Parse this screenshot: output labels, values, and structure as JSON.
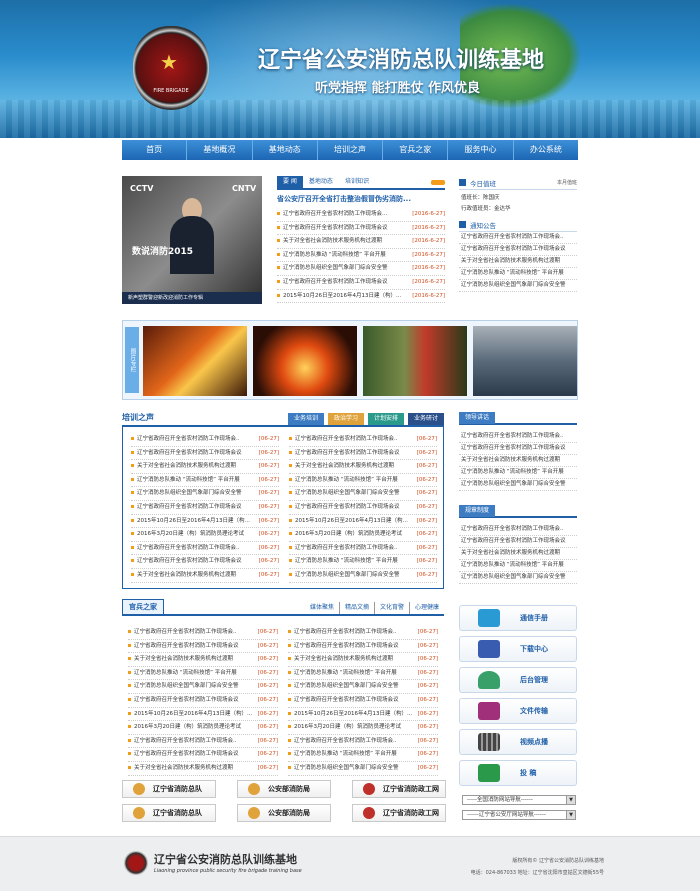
{
  "header": {
    "title": "辽宁省公安消防总队训练基地",
    "slogan": "听党指挥  能打胜仗  作风优良",
    "badge_text": "FIRE BRIGADE"
  },
  "nav": [
    "首页",
    "基地概况",
    "基地动态",
    "培训之声",
    "官兵之家",
    "服务中心",
    "办公系统"
  ],
  "video": {
    "logo_left": "CCTV",
    "logo_right": "CNTV",
    "overlay": "数说消防2015",
    "caption": "新声塑群警迎新改迎消防工作专辑"
  },
  "news": {
    "tabs": [
      "要 闻",
      "基地动态",
      "培训知识"
    ],
    "headline": "省公安厅召开全省打击整治假冒伪劣消防...",
    "items": [
      {
        "title": "辽宁省政府召开全省农村消防工作现场会...",
        "date": "[2016-6-27]"
      },
      {
        "title": "辽宁省政府召开全省农村消防工作现场会议",
        "date": "[2016-6-27]"
      },
      {
        "title": "关于对全省社会消防技术服务机构过渡期",
        "date": "[2016-6-27]"
      },
      {
        "title": "辽宁消防总队推动 “流动科技馆” 平台开展",
        "date": "[2016-6-27]"
      },
      {
        "title": "辽宁消防总队组织全国气象部门综合安全警",
        "date": "[2016-6-27]"
      },
      {
        "title": "辽宁省政府召开全省农村消防工作现场会议",
        "date": "[2016-6-27]"
      },
      {
        "title": "2015年10月26日至2016年4月13日建（构）...",
        "date": "[2016-6-27]"
      }
    ]
  },
  "duty": {
    "title": "今日值班",
    "more": "本月值班",
    "leader_label": "值班长：",
    "leader": "陈国庆",
    "staff_label": "行政值班员：",
    "staff": "金达华"
  },
  "notice": {
    "title": "通知公告",
    "items": [
      "辽宁省政府召开全省农村消防工作现场会..",
      "辽宁省政府召开全省农村消防工作现场会议",
      "关于对全省社会消防技术服务机构过渡期",
      "辽宁消防总队推动 “流动科技馆” 平台开展",
      "辽宁消防总队组织全国气象部门综合安全警"
    ]
  },
  "gallery": {
    "label": "图片专栏"
  },
  "training": {
    "title": "培训之声",
    "buttons": [
      {
        "label": "业务培训",
        "color": "#3d7cc2"
      },
      {
        "label": "政治学习",
        "color": "#e0a23a"
      },
      {
        "label": "计划安排",
        "color": "#2a9a8a"
      },
      {
        "label": "业务研讨",
        "color": "#2a4f8a"
      }
    ],
    "left": [
      {
        "title": "辽宁省政府召开全省农村消防工作现场会..",
        "date": "[06-27]"
      },
      {
        "title": "辽宁省政府召开全省农村消防工作现场会议",
        "date": "[06-27]"
      },
      {
        "title": "关于对全省社会消防技术服务机构过渡期",
        "date": "[06-27]"
      },
      {
        "title": "辽宁消防总队推动 “流动科技馆” 平台开展",
        "date": "[06-27]"
      },
      {
        "title": "辽宁消防总队组织全国气象部门综合安全警",
        "date": "[06-27]"
      },
      {
        "title": "辽宁省政府召开全省农村消防工作现场会议",
        "date": "[06-27]"
      },
      {
        "title": "2015年10月26日至2016年4月13日建（构）...",
        "date": "[06-27]"
      },
      {
        "title": "2016年3月20日建（构）筑消防员理论考试",
        "date": "[06-27]"
      },
      {
        "title": "辽宁省政府召开全省农村消防工作现场会..",
        "date": "[06-27]"
      },
      {
        "title": "辽宁省政府召开全省农村消防工作现场会议",
        "date": "[06-27]"
      },
      {
        "title": "关于对全省社会消防技术服务机构过渡期",
        "date": "[06-27]"
      }
    ],
    "right": [
      {
        "title": "辽宁省政府召开全省农村消防工作现场会..",
        "date": "[06-27]"
      },
      {
        "title": "辽宁省政府召开全省农村消防工作现场会议",
        "date": "[06-27]"
      },
      {
        "title": "关于对全省社会消防技术服务机构过渡期",
        "date": "[06-27]"
      },
      {
        "title": "辽宁消防总队推动 “流动科技馆” 平台开展",
        "date": "[06-27]"
      },
      {
        "title": "辽宁消防总队组织全国气象部门综合安全警",
        "date": "[06-27]"
      },
      {
        "title": "辽宁省政府召开全省农村消防工作现场会议",
        "date": "[06-27]"
      },
      {
        "title": "2015年10月26日至2016年4月13日建（构）...",
        "date": "[06-27]"
      },
      {
        "title": "2016年3月20日建（构）筑消防员理论考试",
        "date": "[06-27]"
      },
      {
        "title": "辽宁省政府召开全省农村消防工作现场会..",
        "date": "[06-27]"
      },
      {
        "title": "辽宁消防总队推动 “流动科技馆” 平台开展",
        "date": "[06-27]"
      },
      {
        "title": "辽宁消防总队组织全国气象部门综合安全警",
        "date": "[06-27]"
      }
    ]
  },
  "family": {
    "title": "官兵之家",
    "links": [
      "媒体聚焦",
      "精品文摘",
      "文化育警",
      "心理健康"
    ],
    "left": [
      {
        "title": "辽宁省政府召开全省农村消防工作现场会..",
        "date": "[06-27]"
      },
      {
        "title": "辽宁省政府召开全省农村消防工作现场会议",
        "date": "[06-27]"
      },
      {
        "title": "关于对全省社会消防技术服务机构过渡期",
        "date": "[06-27]"
      },
      {
        "title": "辽宁消防总队推动 “流动科技馆” 平台开展",
        "date": "[06-27]"
      },
      {
        "title": "辽宁消防总队组织全国气象部门综合安全警",
        "date": "[06-27]"
      },
      {
        "title": "辽宁省政府召开全省农村消防工作现场会议",
        "date": "[06-27]"
      },
      {
        "title": "2015年10月26日至2016年4月13日建（构）...",
        "date": "[06-27]"
      },
      {
        "title": "2016年3月20日建（构）筑消防员理论考试",
        "date": "[06-27]"
      },
      {
        "title": "辽宁省政府召开全省农村消防工作现场会..",
        "date": "[06-27]"
      },
      {
        "title": "辽宁省政府召开全省农村消防工作现场会议",
        "date": "[06-27]"
      },
      {
        "title": "关于对全省社会消防技术服务机构过渡期",
        "date": "[06-27]"
      }
    ],
    "right": [
      {
        "title": "辽宁省政府召开全省农村消防工作现场会..",
        "date": "[06-27]"
      },
      {
        "title": "辽宁省政府召开全省农村消防工作现场会议",
        "date": "[06-27]"
      },
      {
        "title": "关于对全省社会消防技术服务机构过渡期",
        "date": "[06-27]"
      },
      {
        "title": "辽宁消防总队推动 “流动科技馆” 平台开展",
        "date": "[06-27]"
      },
      {
        "title": "辽宁消防总队组织全国气象部门综合安全警",
        "date": "[06-27]"
      },
      {
        "title": "辽宁省政府召开全省农村消防工作现场会议",
        "date": "[06-27]"
      },
      {
        "title": "2015年10月26日至2016年4月13日建（构）...",
        "date": "[06-27]"
      },
      {
        "title": "2016年3月20日建（构）筑消防员理论考试",
        "date": "[06-27]"
      },
      {
        "title": "辽宁省政府召开全省农村消防工作现场会..",
        "date": "[06-27]"
      },
      {
        "title": "辽宁消防总队推动 “流动科技馆” 平台开展",
        "date": "[06-27]"
      },
      {
        "title": "辽宁消防总队组织全国气象部门综合安全警",
        "date": "[06-27]"
      }
    ]
  },
  "leader_talk": {
    "title": "领导讲话",
    "items": [
      "辽宁省政府召开全省农村消防工作现场会..",
      "辽宁省政府召开全省农村消防工作现场会议",
      "关于对全省社会消防技术服务机构过渡期",
      "辽宁消防总队推动 “流动科技馆” 平台开展",
      "辽宁消防总队组织全国气象部门综合安全警"
    ]
  },
  "rules": {
    "title": "规章制度",
    "items": [
      "辽宁省政府召开全省农村消防工作现场会..",
      "辽宁省政府召开全省农村消防工作现场会议",
      "关于对全省社会消防技术服务机构过渡期",
      "辽宁消防总队推动 “流动科技馆” 平台开展",
      "辽宁消防总队组织全国气象部门综合安全警"
    ]
  },
  "services": [
    {
      "label": "通信手册",
      "icon": "paper-plane-icon",
      "color": "#2a9ad4"
    },
    {
      "label": "下载中心",
      "icon": "floppy-disk-icon",
      "color": "#3a5cb0"
    },
    {
      "label": "后台管理",
      "icon": "user-icon",
      "color": "#3aa06a"
    },
    {
      "label": "文件传输",
      "icon": "folder-icon",
      "color": "#a0307a"
    },
    {
      "label": "视频点播",
      "icon": "film-icon",
      "color": "#444444"
    },
    {
      "label": "投    稿",
      "icon": "envelope-icon",
      "color": "#2a9a4a"
    }
  ],
  "selects": [
    "-----全国消防网站导航------",
    "------辽宁省公安厅网站导航------"
  ],
  "links_row": [
    {
      "label": "辽宁省消防总队",
      "color": "#e0a23a"
    },
    {
      "label": "公安部消防局",
      "color": "#e0a23a"
    },
    {
      "label": "辽宁省消防政工网",
      "color": "#c0302a"
    },
    {
      "label": "辽宁省消防总队",
      "color": "#e0a23a"
    },
    {
      "label": "公安部消防局",
      "color": "#e0a23a"
    },
    {
      "label": "辽宁省消防政工网",
      "color": "#c0302a"
    }
  ],
  "footer": {
    "title": "辽宁省公安消防总队训练基地",
    "subtitle": "Liaoning province public security fire brigade training base",
    "copyright": "版权所有© 辽宁省公安消防总队训练基地",
    "contact": "电话：024-867033   地址：辽宁省沈阳市皇姑区文德街55号"
  },
  "colors": {
    "accent": "#1f5fa8",
    "date": "#d14b1b",
    "bullet": "#f39c1a"
  }
}
